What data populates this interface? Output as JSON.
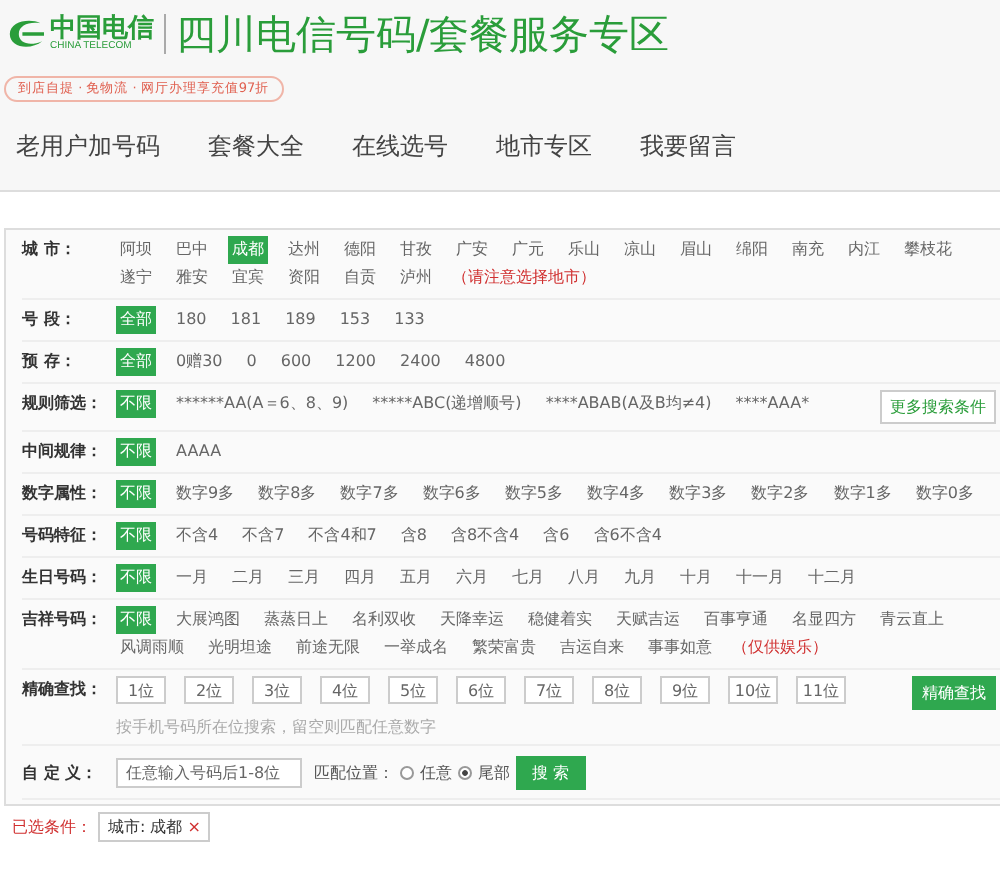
{
  "brand": {
    "name_cn": "中国电信",
    "name_en": "CHINA TELECOM"
  },
  "site_title": "四川电信号码/套餐服务专区",
  "promo": "到店自提 · 免物流 · 网厅办理享充值97折",
  "nav": [
    {
      "label": "老用户加号码",
      "selected": false
    },
    {
      "label": "套餐大全",
      "selected": false
    },
    {
      "label": "在线选号",
      "selected": false
    },
    {
      "label": "地市专区",
      "selected": false
    },
    {
      "label": "我要留言",
      "selected": false
    }
  ],
  "filters": [
    {
      "kind": "options",
      "label": "城 市：",
      "options": [
        {
          "label": "阿坝",
          "selected": false
        },
        {
          "label": "巴中",
          "selected": false
        },
        {
          "label": "成都",
          "selected": true
        },
        {
          "label": "达州",
          "selected": false
        },
        {
          "label": "德阳",
          "selected": false
        },
        {
          "label": "甘孜",
          "selected": false
        },
        {
          "label": "广安",
          "selected": false
        },
        {
          "label": "广元",
          "selected": false
        },
        {
          "label": "乐山",
          "selected": false
        },
        {
          "label": "凉山",
          "selected": false
        },
        {
          "label": "眉山",
          "selected": false
        },
        {
          "label": "绵阳",
          "selected": false
        },
        {
          "label": "南充",
          "selected": false
        },
        {
          "label": "内江",
          "selected": false
        },
        {
          "label": "攀枝花",
          "selected": false
        },
        {
          "label": "遂宁",
          "selected": false
        },
        {
          "label": "雅安",
          "selected": false
        },
        {
          "label": "宜宾",
          "selected": false
        },
        {
          "label": "资阳",
          "selected": false
        },
        {
          "label": "自贡",
          "selected": false
        },
        {
          "label": "泸州",
          "selected": false
        }
      ],
      "note": "（请注意选择地市）"
    },
    {
      "kind": "options",
      "label": "号 段：",
      "options": [
        {
          "label": "全部",
          "selected": true
        },
        {
          "label": "180",
          "selected": false
        },
        {
          "label": "181",
          "selected": false
        },
        {
          "label": "189",
          "selected": false
        },
        {
          "label": "153",
          "selected": false
        },
        {
          "label": "133",
          "selected": false
        }
      ]
    },
    {
      "kind": "options",
      "label": "预 存：",
      "options": [
        {
          "label": "全部",
          "selected": true
        },
        {
          "label": "0赠30",
          "selected": false
        },
        {
          "label": "0",
          "selected": false
        },
        {
          "label": "600",
          "selected": false
        },
        {
          "label": "1200",
          "selected": false
        },
        {
          "label": "2400",
          "selected": false
        },
        {
          "label": "4800",
          "selected": false
        }
      ]
    },
    {
      "kind": "options",
      "label": "规则筛选：",
      "options": [
        {
          "label": "不限",
          "selected": true
        },
        {
          "label": "******AA(A＝6、8、9)",
          "selected": false
        },
        {
          "label": "*****ABC(递增顺号)",
          "selected": false
        },
        {
          "label": "****ABAB(A及B均≠4)",
          "selected": false
        },
        {
          "label": "****AAA*",
          "selected": false
        }
      ],
      "more_button": "更多搜索条件"
    },
    {
      "kind": "options",
      "label": "中间规律：",
      "options": [
        {
          "label": "不限",
          "selected": true
        },
        {
          "label": "AAAA",
          "selected": false
        }
      ]
    },
    {
      "kind": "options",
      "label": "数字属性：",
      "options": [
        {
          "label": "不限",
          "selected": true
        },
        {
          "label": "数字9多",
          "selected": false
        },
        {
          "label": "数字8多",
          "selected": false
        },
        {
          "label": "数字7多",
          "selected": false
        },
        {
          "label": "数字6多",
          "selected": false
        },
        {
          "label": "数字5多",
          "selected": false
        },
        {
          "label": "数字4多",
          "selected": false
        },
        {
          "label": "数字3多",
          "selected": false
        },
        {
          "label": "数字2多",
          "selected": false
        },
        {
          "label": "数字1多",
          "selected": false
        },
        {
          "label": "数字0多",
          "selected": false
        }
      ]
    },
    {
      "kind": "options",
      "label": "号码特征：",
      "options": [
        {
          "label": "不限",
          "selected": true
        },
        {
          "label": "不含4",
          "selected": false
        },
        {
          "label": "不含7",
          "selected": false
        },
        {
          "label": "不含4和7",
          "selected": false
        },
        {
          "label": "含8",
          "selected": false
        },
        {
          "label": "含8不含4",
          "selected": false
        },
        {
          "label": "含6",
          "selected": false
        },
        {
          "label": "含6不含4",
          "selected": false
        }
      ]
    },
    {
      "kind": "options",
      "label": "生日号码：",
      "options": [
        {
          "label": "不限",
          "selected": true
        },
        {
          "label": "一月",
          "selected": false
        },
        {
          "label": "二月",
          "selected": false
        },
        {
          "label": "三月",
          "selected": false
        },
        {
          "label": "四月",
          "selected": false
        },
        {
          "label": "五月",
          "selected": false
        },
        {
          "label": "六月",
          "selected": false
        },
        {
          "label": "七月",
          "selected": false
        },
        {
          "label": "八月",
          "selected": false
        },
        {
          "label": "九月",
          "selected": false
        },
        {
          "label": "十月",
          "selected": false
        },
        {
          "label": "十一月",
          "selected": false
        },
        {
          "label": "十二月",
          "selected": false
        }
      ]
    },
    {
      "kind": "options",
      "label": "吉祥号码：",
      "options": [
        {
          "label": "不限",
          "selected": true
        },
        {
          "label": "大展鸿图",
          "selected": false
        },
        {
          "label": "蒸蒸日上",
          "selected": false
        },
        {
          "label": "名利双收",
          "selected": false
        },
        {
          "label": "天降幸运",
          "selected": false
        },
        {
          "label": "稳健着实",
          "selected": false
        },
        {
          "label": "天赋吉运",
          "selected": false
        },
        {
          "label": "百事亨通",
          "selected": false
        },
        {
          "label": "名显四方",
          "selected": false
        },
        {
          "label": "青云直上",
          "selected": false
        },
        {
          "label": "风调雨顺",
          "selected": false
        },
        {
          "label": "光明坦途",
          "selected": false
        },
        {
          "label": "前途无限",
          "selected": false
        },
        {
          "label": "一举成名",
          "selected": false
        },
        {
          "label": "繁荣富贵",
          "selected": false
        },
        {
          "label": "吉运自来",
          "selected": false
        },
        {
          "label": "事事如意",
          "selected": false
        }
      ],
      "note": "（仅供娱乐）"
    },
    {
      "kind": "digits",
      "label": "精确查找：",
      "placeholders": [
        "1位",
        "2位",
        "3位",
        "4位",
        "5位",
        "6位",
        "7位",
        "8位",
        "9位",
        "10位",
        "11位"
      ],
      "button": "精确查找",
      "hint": "按手机号码所在位搜索，留空则匹配任意数字"
    },
    {
      "kind": "custom",
      "label": "自 定 义：",
      "placeholder": "任意输入号码后1-8位",
      "match_label": "匹配位置：",
      "choices": [
        {
          "label": "任意",
          "selected": false
        },
        {
          "label": "尾部",
          "selected": true
        }
      ],
      "button": "搜 索"
    }
  ],
  "selected_conditions": {
    "label": "已选条件：",
    "tags": [
      {
        "text": "城市: 成都",
        "remove": "×"
      }
    ]
  }
}
